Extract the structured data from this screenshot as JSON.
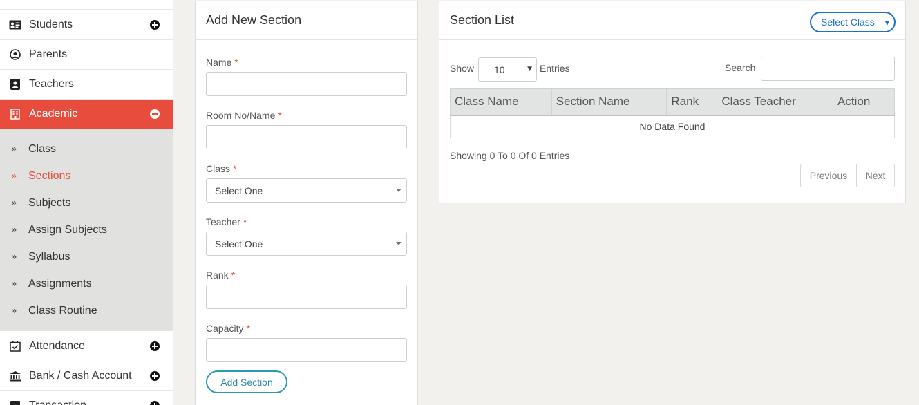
{
  "sidebar": {
    "items_top": [
      {
        "label": "Students",
        "icon": "id-card-icon"
      },
      {
        "label": "Parents",
        "icon": "user-circle-icon"
      },
      {
        "label": "Teachers",
        "icon": "teacher-icon"
      }
    ],
    "academic": {
      "label": "Academic",
      "icon": "building-icon"
    },
    "submenu": [
      {
        "label": "Class"
      },
      {
        "label": "Sections"
      },
      {
        "label": "Subjects"
      },
      {
        "label": "Assign Subjects"
      },
      {
        "label": "Syllabus"
      },
      {
        "label": "Assignments"
      },
      {
        "label": "Class Routine"
      }
    ],
    "items_bottom": [
      {
        "label": "Attendance",
        "icon": "calendar-check-icon"
      },
      {
        "label": "Bank / Cash Account",
        "icon": "bank-icon"
      },
      {
        "label": "Transaction",
        "icon": "transaction-icon"
      }
    ],
    "chevron": "»",
    "active_color": "#e74c3c"
  },
  "form": {
    "title": "Add New Section",
    "fields": [
      {
        "label": "Name",
        "value": ""
      },
      {
        "label": "Room No/Name",
        "value": ""
      },
      {
        "label": "Class",
        "value": "Select One"
      },
      {
        "label": "Teacher",
        "value": "Select One"
      },
      {
        "label": "Rank",
        "value": ""
      },
      {
        "label": "Capacity",
        "value": ""
      }
    ],
    "required_mark": "*",
    "submit_label": "Add Section"
  },
  "list": {
    "title": "Section List",
    "select_class_label": "Select Class",
    "show_label": "Show",
    "entries_value": "10",
    "entries_label": "Entries",
    "search_label": "Search",
    "search_value": "",
    "columns": [
      "Class Name",
      "Section Name",
      "Rank",
      "Class Teacher",
      "Action"
    ],
    "empty_message": "No Data Found",
    "info": "Showing 0 To 0 Of 0 Entries",
    "prev_label": "Previous",
    "next_label": "Next"
  },
  "colors": {
    "accent_red": "#e74c3c",
    "teal": "#2b9bb0",
    "blue": "#1a73c9"
  }
}
